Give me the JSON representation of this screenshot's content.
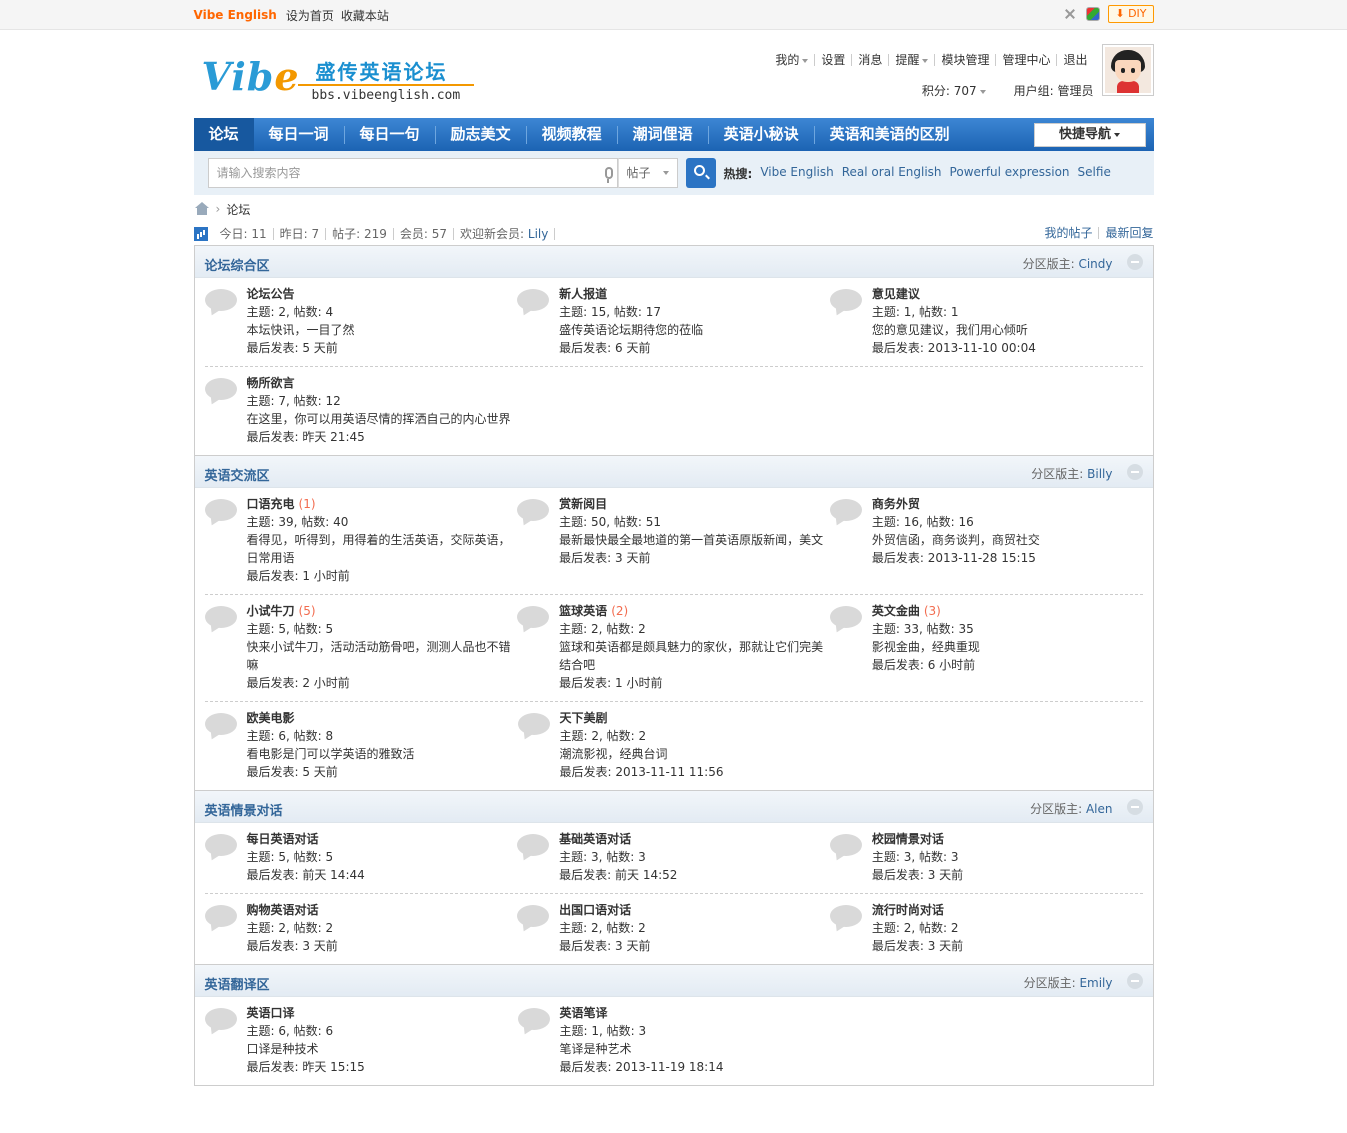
{
  "topbar": {
    "brand": "Vibe English",
    "links": [
      "设为首页",
      "收藏本站"
    ],
    "diy": "DIY"
  },
  "header": {
    "logo_text": "Vibe",
    "logo_cn": "盛传英语论坛",
    "logo_url": "bbs.vibeenglish.com",
    "user_links": [
      "我的",
      "设置",
      "消息",
      "提醒",
      "模块管理",
      "管理中心",
      "退出"
    ],
    "points": "积分: 707",
    "usergroup": "用户组: 管理员"
  },
  "nav": {
    "items": [
      "论坛",
      "每日一词",
      "每日一句",
      "励志美文",
      "视频教程",
      "潮词俚语",
      "英语小秘诀",
      "英语和美语的区别"
    ],
    "quick": "快捷导航"
  },
  "search": {
    "placeholder": "请输入搜索内容",
    "type": "帖子",
    "hot_label": "热搜:",
    "hot_words": [
      "Vibe English",
      "Real oral English",
      "Powerful expression",
      "Selfie"
    ]
  },
  "breadcrumb": {
    "current": "论坛"
  },
  "stats": {
    "today": "今日: 11",
    "yesterday": "昨日: 7",
    "posts": "帖子: 219",
    "members": "会员: 57",
    "welcome_label": "欢迎新会员: ",
    "welcome_name": "Lily",
    "my_posts": "我的帖子",
    "latest_reply": "最新回复"
  },
  "groups": [
    {
      "title": "论坛综合区",
      "mod_label": "分区版主: ",
      "mod": "Cindy",
      "rows": [
        [
          {
            "name": "论坛公告",
            "new": "",
            "meta": "主题: 2, 帖数: 4",
            "desc": "本坛快讯，一目了然",
            "last": "最后发表: 5 天前"
          },
          {
            "name": "新人报道",
            "new": "",
            "meta": "主题: 15, 帖数: 17",
            "desc": "盛传英语论坛期待您的莅临",
            "last": "最后发表: 6 天前"
          },
          {
            "name": "意见建议",
            "new": "",
            "meta": "主题: 1, 帖数: 1",
            "desc": "您的意见建议，我们用心倾听",
            "last": "最后发表: 2013-11-10 00:04"
          }
        ],
        [
          {
            "name": "畅所欲言",
            "new": "",
            "meta": "主题: 7, 帖数: 12",
            "desc": "在这里，你可以用英语尽情的挥洒自己的内心世界",
            "last": "最后发表: 昨天 21:45"
          }
        ]
      ]
    },
    {
      "title": "英语交流区",
      "mod_label": "分区版主: ",
      "mod": "Billy",
      "rows": [
        [
          {
            "name": "口语充电",
            "new": "(1)",
            "meta": "主题: 39, 帖数: 40",
            "desc": "看得见，听得到，用得着的生活英语，交际英语，日常用语",
            "last": "最后发表: 1 小时前"
          },
          {
            "name": "赏新阅目",
            "new": "",
            "meta": "主题: 50, 帖数: 51",
            "desc": "最新最快最全最地道的第一首英语原版新闻，美文",
            "last": "最后发表: 3 天前"
          },
          {
            "name": "商务外贸",
            "new": "",
            "meta": "主题: 16, 帖数: 16",
            "desc": "外贸信函，商务谈判，商贸社交",
            "last": "最后发表: 2013-11-28 15:15"
          }
        ],
        [
          {
            "name": "小试牛刀",
            "new": "(5)",
            "meta": "主题: 5, 帖数: 5",
            "desc": "快来小试牛刀，活动活动筋骨吧，测测人品也不错嘛",
            "last": "最后发表: 2 小时前"
          },
          {
            "name": "篮球英语",
            "new": "(2)",
            "meta": "主题: 2, 帖数: 2",
            "desc": "篮球和英语都是颇具魅力的家伙，那就让它们完美结合吧",
            "last": "最后发表: 1 小时前"
          },
          {
            "name": "英文金曲",
            "new": "(3)",
            "meta": "主题: 33, 帖数: 35",
            "desc": "影视金曲，经典重现",
            "last": "最后发表: 6 小时前"
          }
        ],
        [
          {
            "name": "欧美电影",
            "new": "",
            "meta": "主题: 6, 帖数: 8",
            "desc": "看电影是门可以学英语的雅致活",
            "last": "最后发表: 5 天前"
          },
          {
            "name": "天下美剧",
            "new": "",
            "meta": "主题: 2, 帖数: 2",
            "desc": "潮流影视，经典台词",
            "last": "最后发表: 2013-11-11 11:56"
          }
        ]
      ]
    },
    {
      "title": "英语情景对话",
      "mod_label": "分区版主: ",
      "mod": "Alen",
      "rows": [
        [
          {
            "name": "每日英语对话",
            "new": "",
            "meta": "主题: 5, 帖数: 5",
            "desc": "",
            "last": "最后发表: 前天 14:44"
          },
          {
            "name": "基础英语对话",
            "new": "",
            "meta": "主题: 3, 帖数: 3",
            "desc": "",
            "last": "最后发表: 前天 14:52"
          },
          {
            "name": "校园情景对话",
            "new": "",
            "meta": "主题: 3, 帖数: 3",
            "desc": "",
            "last": "最后发表: 3 天前"
          }
        ],
        [
          {
            "name": "购物英语对话",
            "new": "",
            "meta": "主题: 2, 帖数: 2",
            "desc": "",
            "last": "最后发表: 3 天前"
          },
          {
            "name": "出国口语对话",
            "new": "",
            "meta": "主题: 2, 帖数: 2",
            "desc": "",
            "last": "最后发表: 3 天前"
          },
          {
            "name": "流行时尚对话",
            "new": "",
            "meta": "主题: 2, 帖数: 2",
            "desc": "",
            "last": "最后发表: 3 天前"
          }
        ]
      ]
    },
    {
      "title": "英语翻译区",
      "mod_label": "分区版主: ",
      "mod": "Emily",
      "rows": [
        [
          {
            "name": "英语口译",
            "new": "",
            "meta": "主题: 6, 帖数: 6",
            "desc": "口译是种技术",
            "last": "最后发表: 昨天 15:15"
          },
          {
            "name": "英语笔译",
            "new": "",
            "meta": "主题: 1, 帖数: 3",
            "desc": "笔译是种艺术",
            "last": "最后发表: 2013-11-19 18:14"
          }
        ]
      ]
    }
  ]
}
